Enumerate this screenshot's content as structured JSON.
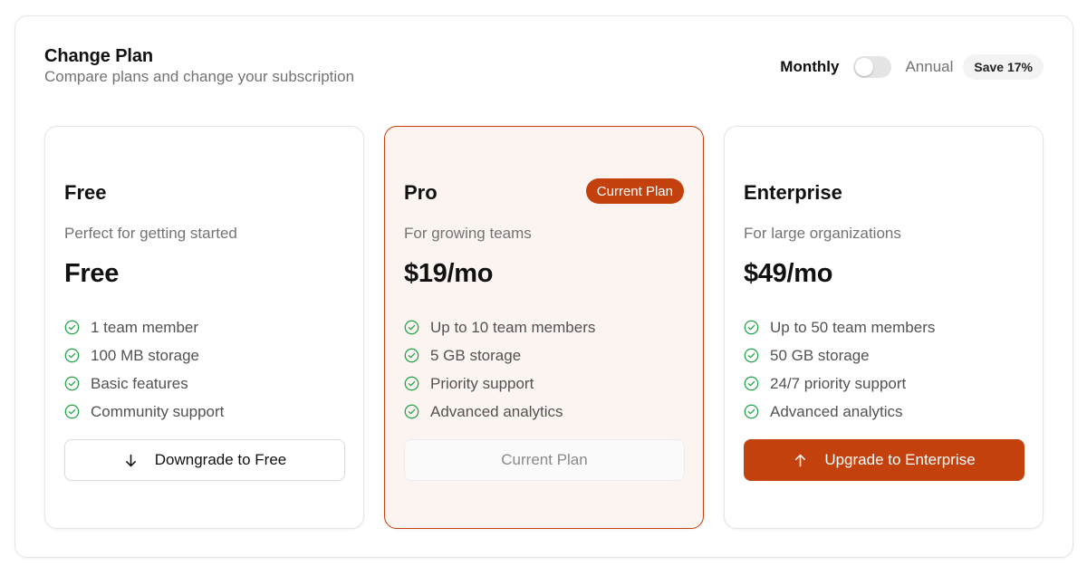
{
  "header": {
    "title": "Change Plan",
    "subtitle": "Compare plans and change your subscription"
  },
  "billing": {
    "monthly_label": "Monthly",
    "annual_label": "Annual",
    "save_badge": "Save 17%",
    "toggle_on": false
  },
  "colors": {
    "accent": "#c2410c",
    "check": "#22a447",
    "current_card_bg": "#fcf4f1"
  },
  "plans": [
    {
      "name": "Free",
      "description": "Perfect for getting started",
      "price": "Free",
      "features": [
        "1 team member",
        "100 MB storage",
        "Basic features",
        "Community support"
      ],
      "button_label": "Downgrade to Free",
      "button_icon": "arrow-down-icon"
    },
    {
      "name": "Pro",
      "badge": "Current Plan",
      "description": "For growing teams",
      "price": "$19/mo",
      "features": [
        "Up to 10 team members",
        "5 GB storage",
        "Priority support",
        "Advanced analytics"
      ],
      "button_label": "Current Plan"
    },
    {
      "name": "Enterprise",
      "description": "For large organizations",
      "price": "$49/mo",
      "features": [
        "Up to 50 team members",
        "50 GB storage",
        "24/7 priority support",
        "Advanced analytics"
      ],
      "button_label": "Upgrade to Enterprise",
      "button_icon": "arrow-up-icon"
    }
  ]
}
